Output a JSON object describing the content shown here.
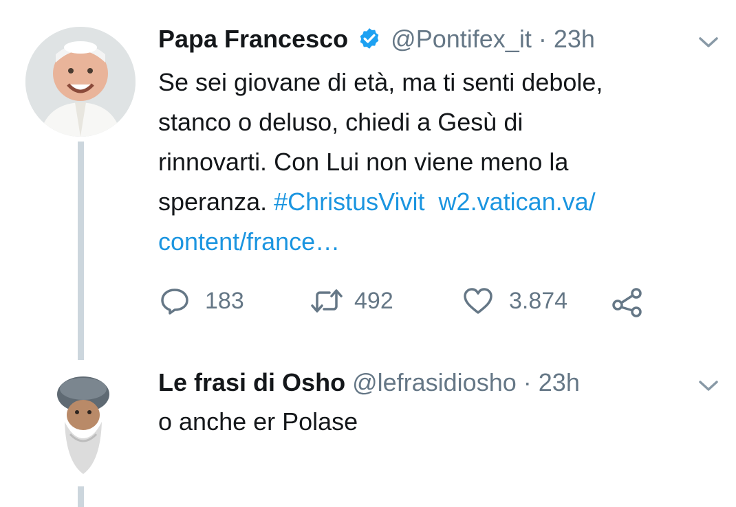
{
  "colors": {
    "text": "#14171a",
    "secondary": "#657786",
    "link": "#1b95e0",
    "verified": "#1da1f2",
    "thread_line": "#ccd6dd"
  },
  "tweets": [
    {
      "author_name": "Papa Francesco",
      "verified": true,
      "handle": "@Pontifex_it",
      "separator": "·",
      "time": "23h",
      "text_lines": [
        "Se sei giovane di età, ma ti senti debole,",
        "stanco o deluso, chiedi a Gesù di",
        "rinnovarti. Con Lui non viene meno la"
      ],
      "text_last_prefix": "speranza. ",
      "hashtag": "#ChristusVivit",
      "link_part1": "w2.vatican.va/",
      "link_part2": "content/france…",
      "replies": "183",
      "retweets": "492",
      "likes": "3.874"
    },
    {
      "author_name": "Le frasi di Osho",
      "handle": "@lefrasidiosho",
      "separator": "·",
      "time": "23h",
      "text": "o anche er Polase"
    }
  ]
}
